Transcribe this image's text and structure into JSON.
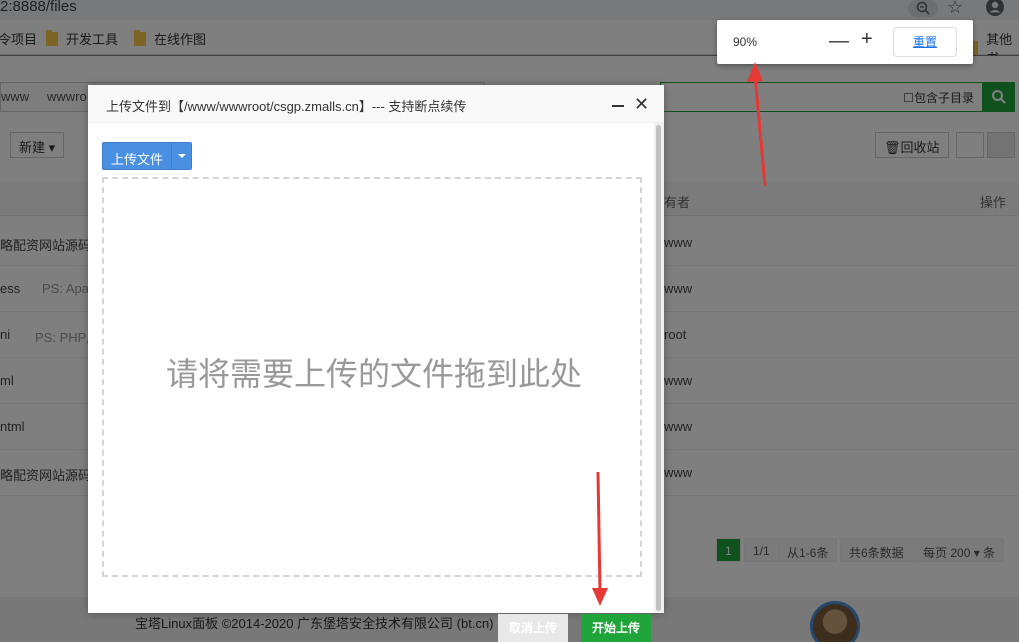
{
  "browser": {
    "url": "2:8888/files",
    "bookmarks": [
      "令项目",
      "开发工具",
      "在线作图",
      "其他书"
    ]
  },
  "zoom_popup": {
    "value": "90%",
    "minus": "—",
    "plus": "+",
    "reset": "重置"
  },
  "page": {
    "breadcrumbs": [
      "www",
      "wwwro"
    ],
    "search_option": "包含子目录",
    "toolbar": {
      "new": "新建",
      "recycle": "回收站"
    },
    "table_header": {
      "owner": "有者",
      "action": "操作"
    },
    "rows": [
      {
        "name": "略配资网站源码.",
        "ps": "",
        "owner": "www"
      },
      {
        "name": "ess",
        "ps": "PS: Apa",
        "owner": "www"
      },
      {
        "name": "ni",
        "ps": "PS: PHP用",
        "owner": "root"
      },
      {
        "name": "ml",
        "ps": "",
        "owner": "www"
      },
      {
        "name": "ntml",
        "ps": "",
        "owner": "www"
      },
      {
        "name": "略配资网站源码",
        "ps": "",
        "owner": "www"
      }
    ],
    "pagination": {
      "current": "1",
      "pages": "1/1",
      "range": "从1-6条",
      "total": "共6条数据",
      "per_page_label": "每页",
      "per_page_value": "200",
      "per_page_suffix": "条"
    },
    "footer": "宝塔Linux面板 ©2014-2020 广东堡塔安全技术有限公司 (bt.cn)"
  },
  "dialog": {
    "title": "上传文件到【/www/wwwroot/csgp.zmalls.cn】--- 支持断点续传",
    "upload_button": "上传文件",
    "drop_hint": "请将需要上传的文件拖到此处",
    "cancel": "取消上传",
    "start": "开始上传"
  },
  "colors": {
    "accent_green": "#20a53a",
    "upload_blue": "#4a90e2",
    "arrow_red": "#e53935"
  }
}
